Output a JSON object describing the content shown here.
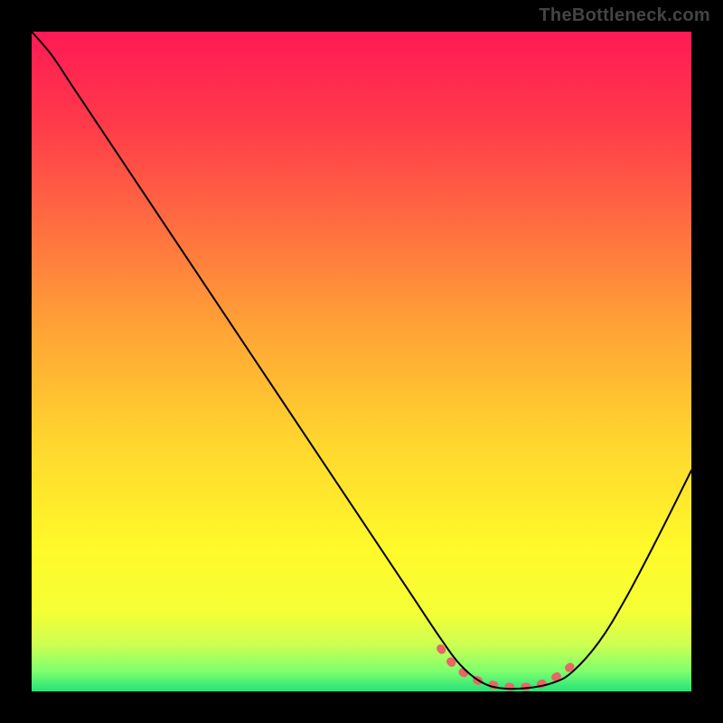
{
  "watermark": "TheBottleneck.com",
  "chart_data": {
    "type": "line",
    "title": "",
    "xlabel": "",
    "ylabel": "",
    "xlim": [
      0,
      100
    ],
    "ylim": [
      0,
      100
    ],
    "gradient_stops": [
      {
        "offset": 0.0,
        "color": "#ff1a55"
      },
      {
        "offset": 0.14,
        "color": "#ff3a4a"
      },
      {
        "offset": 0.3,
        "color": "#ff7040"
      },
      {
        "offset": 0.45,
        "color": "#ffa336"
      },
      {
        "offset": 0.62,
        "color": "#ffd52e"
      },
      {
        "offset": 0.78,
        "color": "#fff92a"
      },
      {
        "offset": 0.88,
        "color": "#f4ff35"
      },
      {
        "offset": 0.93,
        "color": "#ccff52"
      },
      {
        "offset": 0.97,
        "color": "#7dff6e"
      },
      {
        "offset": 1.0,
        "color": "#24e27a"
      }
    ],
    "series": [
      {
        "name": "bottleneck-curve",
        "color": "#000000",
        "stroke_width": 2,
        "points": [
          {
            "x": 0.0,
            "y": 100.0
          },
          {
            "x": 3.0,
            "y": 96.5
          },
          {
            "x": 6.0,
            "y": 92.0
          },
          {
            "x": 10.0,
            "y": 86.0
          },
          {
            "x": 20.0,
            "y": 71.0
          },
          {
            "x": 30.0,
            "y": 56.0
          },
          {
            "x": 40.0,
            "y": 41.0
          },
          {
            "x": 50.0,
            "y": 26.0
          },
          {
            "x": 57.0,
            "y": 15.5
          },
          {
            "x": 62.0,
            "y": 8.0
          },
          {
            "x": 65.0,
            "y": 4.0
          },
          {
            "x": 68.0,
            "y": 1.5
          },
          {
            "x": 71.0,
            "y": 0.5
          },
          {
            "x": 75.0,
            "y": 0.5
          },
          {
            "x": 79.0,
            "y": 1.3
          },
          {
            "x": 82.0,
            "y": 3.0
          },
          {
            "x": 86.0,
            "y": 7.5
          },
          {
            "x": 90.0,
            "y": 14.0
          },
          {
            "x": 95.0,
            "y": 23.5
          },
          {
            "x": 100.0,
            "y": 33.5
          }
        ]
      },
      {
        "name": "optimal-marker",
        "color": "#e86666",
        "stroke_width": 9,
        "points": [
          {
            "x": 62.0,
            "y": 6.5
          },
          {
            "x": 64.0,
            "y": 4.0
          },
          {
            "x": 66.5,
            "y": 2.2
          },
          {
            "x": 69.0,
            "y": 1.2
          },
          {
            "x": 72.0,
            "y": 0.7
          },
          {
            "x": 75.0,
            "y": 0.7
          },
          {
            "x": 77.5,
            "y": 1.2
          },
          {
            "x": 80.0,
            "y": 2.5
          },
          {
            "x": 82.0,
            "y": 4.0
          }
        ]
      }
    ]
  }
}
